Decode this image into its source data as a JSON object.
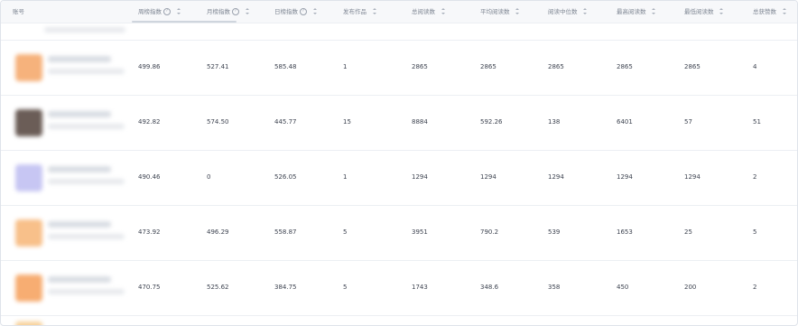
{
  "table": {
    "columns": [
      {
        "key": "account",
        "label": "账号",
        "help": false,
        "sortable": false
      },
      {
        "key": "weekly",
        "label": "周榜指数",
        "help": true,
        "sortable": true
      },
      {
        "key": "monthly",
        "label": "月榜指数",
        "help": true,
        "sortable": true
      },
      {
        "key": "daily",
        "label": "日榜指数",
        "help": true,
        "sortable": true
      },
      {
        "key": "works",
        "label": "发布作品",
        "help": false,
        "sortable": true
      },
      {
        "key": "total_reads",
        "label": "总阅读数",
        "help": false,
        "sortable": true
      },
      {
        "key": "avg_reads",
        "label": "平均阅读数",
        "help": false,
        "sortable": true
      },
      {
        "key": "median_reads",
        "label": "阅读中位数",
        "help": false,
        "sortable": true
      },
      {
        "key": "max_reads",
        "label": "最高阅读数",
        "help": false,
        "sortable": true
      },
      {
        "key": "min_reads",
        "label": "最低阅读数",
        "help": false,
        "sortable": true
      },
      {
        "key": "likes",
        "label": "总获赞数",
        "help": false,
        "sortable": true
      }
    ],
    "help_glyph": "?",
    "rows": [
      {
        "avatar_color": "#f6b27c",
        "cells": [
          "499.86",
          "527.41",
          "585.48",
          "1",
          "2865",
          "2865",
          "2865",
          "2865",
          "2865",
          "4"
        ]
      },
      {
        "avatar_color": "#6b5d57",
        "cells": [
          "492.82",
          "574.50",
          "445.77",
          "15",
          "8884",
          "592.26",
          "138",
          "6401",
          "57",
          "51"
        ]
      },
      {
        "avatar_color": "#c7c6f3",
        "cells": [
          "490.46",
          "0",
          "526.05",
          "1",
          "1294",
          "1294",
          "1294",
          "1294",
          "1294",
          "2"
        ]
      },
      {
        "avatar_color": "#f8c08a",
        "cells": [
          "473.92",
          "496.29",
          "558.87",
          "5",
          "3951",
          "790.2",
          "539",
          "1653",
          "25",
          "5"
        ]
      },
      {
        "avatar_color": "#f7ad72",
        "cells": [
          "470.75",
          "525.62",
          "384.75",
          "5",
          "1743",
          "348.6",
          "358",
          "450",
          "200",
          "2"
        ]
      }
    ]
  }
}
